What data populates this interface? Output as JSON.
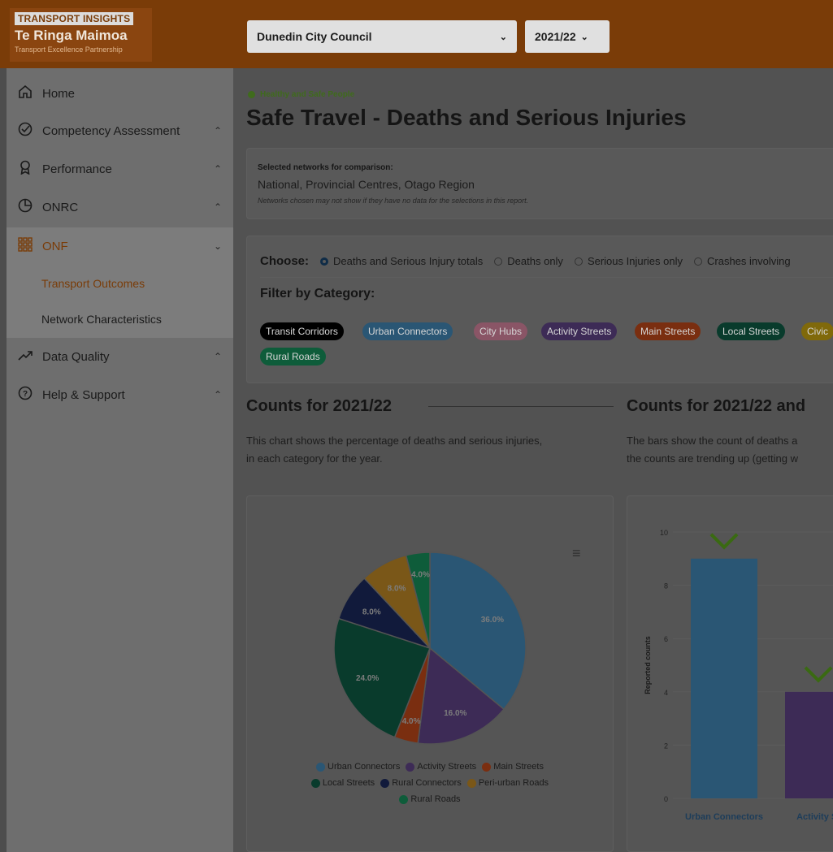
{
  "brand": {
    "line1": "TRANSPORT INSIGHTS",
    "line2": "Te Ringa Maimoa",
    "line3": "Transport Excellence Partnership"
  },
  "header": {
    "council": "Dunedin City Council",
    "year": "2021/22"
  },
  "sidebar": {
    "items": [
      {
        "label": "Home",
        "icon": "home-icon"
      },
      {
        "label": "Competency Assessment",
        "icon": "check-circle-icon"
      },
      {
        "label": "Performance",
        "icon": "award-icon"
      },
      {
        "label": "ONRC",
        "icon": "pie-icon"
      },
      {
        "label": "ONF",
        "icon": "grid-icon"
      },
      {
        "label": "Data Quality",
        "icon": "trend-icon"
      },
      {
        "label": "Help & Support",
        "icon": "help-icon"
      }
    ],
    "sub": [
      "Transport Outcomes",
      "Network Characteristics"
    ]
  },
  "main": {
    "tag": "Healthy and Safe People",
    "title": "Safe Travel - Deaths and Serious Injuries",
    "networks": {
      "heading": "Selected networks for comparison:",
      "value": "National, Provincial Centres, Otago Region",
      "note": "Networks chosen may not show if they have no data for the selections in this report."
    },
    "choose_label": "Choose:",
    "options": [
      "Deaths and Serious Injury totals",
      "Deaths only",
      "Serious Injuries only",
      "Crashes involving"
    ],
    "filter_label": "Filter by Category:",
    "chips": [
      {
        "label": "Transit Corridors",
        "color": "#000000"
      },
      {
        "label": "Urban Connectors",
        "color": "#2a5674"
      },
      {
        "label": "City Hubs",
        "color": "#8a5566"
      },
      {
        "label": "Activity Streets",
        "color": "#3d2b56"
      },
      {
        "label": "Main Streets",
        "color": "#7a2e10"
      },
      {
        "label": "Local Streets",
        "color": "#093b2c"
      },
      {
        "label": "Civic",
        "color": "#80690a"
      },
      {
        "label": "Rural Roads",
        "color": "#0e5c3a"
      }
    ],
    "left_section": {
      "title": "Counts for 2021/22",
      "desc1": "This chart shows the percentage of deaths and serious injuries,",
      "desc2": "in each category for the year."
    },
    "right_section": {
      "title": "Counts for 2021/22 and",
      "desc1": "The bars show the count of deaths a",
      "desc2": "the counts are trending up (getting w"
    },
    "pie_menu": "≡"
  },
  "chart_data": [
    {
      "type": "pie",
      "slices": [
        {
          "label": "Urban Connectors",
          "value": 36.0,
          "color": "#2a5674"
        },
        {
          "label": "Activity Streets",
          "value": 16.0,
          "color": "#3d2b56"
        },
        {
          "label": "Main Streets",
          "value": 4.0,
          "color": "#7a2e10"
        },
        {
          "label": "Local Streets",
          "value": 24.0,
          "color": "#093b2c"
        },
        {
          "label": "Rural Connectors",
          "value": 8.0,
          "color": "#111a3b"
        },
        {
          "label": "Peri-urban Roads",
          "value": 8.0,
          "color": "#7a5718"
        },
        {
          "label": "Rural Roads",
          "value": 4.0,
          "color": "#0e5c3a"
        }
      ],
      "data_labels": [
        "36.0%",
        "16.0%",
        "4.0%",
        "24.0%",
        "8.0%",
        "8.0%",
        "4.0%"
      ]
    },
    {
      "type": "bar",
      "ylabel": "Reported counts",
      "ylim": [
        0,
        10
      ],
      "yticks": [
        0,
        2,
        4,
        6,
        8,
        10
      ],
      "categories": [
        "Urban Connectors",
        "Activity St"
      ],
      "values": [
        9,
        4
      ],
      "colors": [
        "#2a5674",
        "#3d2b56"
      ],
      "trend": [
        "down",
        "down"
      ]
    }
  ]
}
